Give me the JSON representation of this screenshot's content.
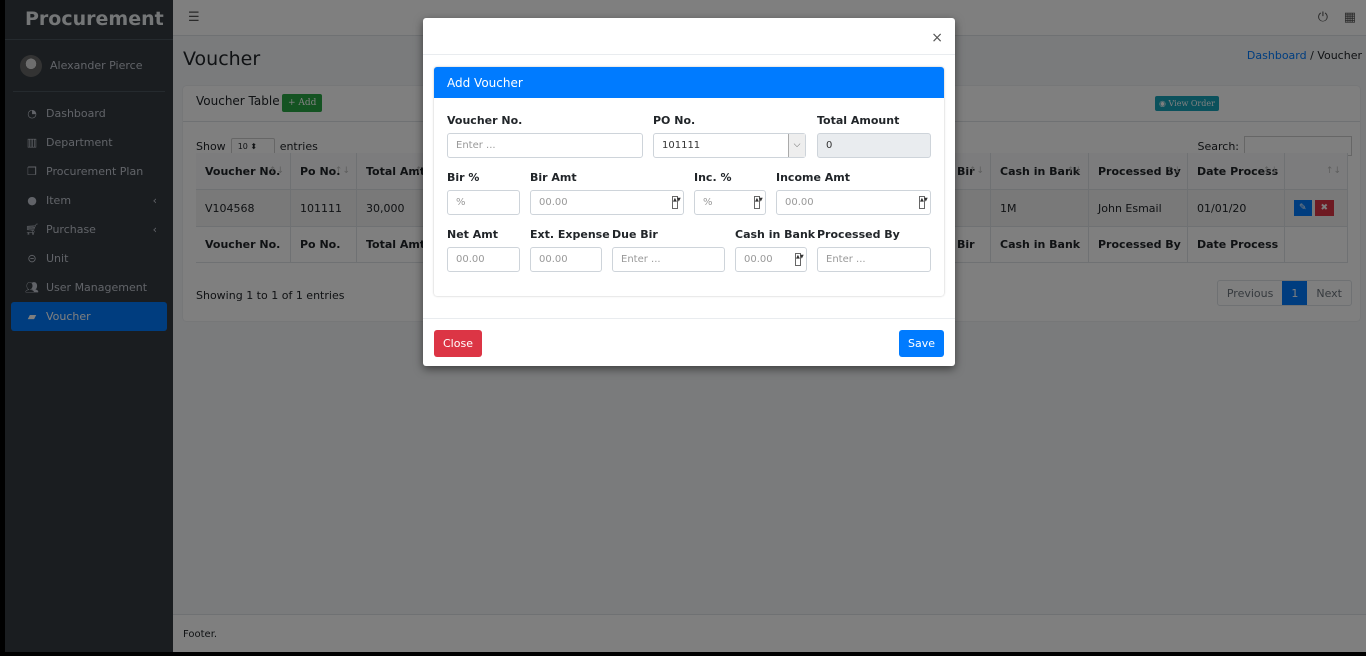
{
  "sidebar": {
    "brand": "Procurement",
    "user": "Alexander Pierce",
    "items": [
      {
        "label": "Dashboard",
        "icon": "tachometer-icon"
      },
      {
        "label": "Department",
        "icon": "building-icon"
      },
      {
        "label": "Procurement Plan",
        "icon": "copy-icon"
      },
      {
        "label": "Item",
        "icon": "palette-icon"
      },
      {
        "label": "Purchase",
        "icon": "cart-icon"
      },
      {
        "label": "Unit",
        "icon": "gamepad-icon"
      },
      {
        "label": "User Management",
        "icon": "users-icon"
      },
      {
        "label": "Voucher",
        "icon": "sticky-note-icon"
      }
    ]
  },
  "page": {
    "title": "Voucher",
    "breadcrumb": [
      "Dashboard",
      "Voucher"
    ]
  },
  "card": {
    "title": "Voucher Table",
    "add": "+ Add",
    "view_order": "View Order",
    "show": "Show",
    "entries_value": "10",
    "entries": "entries",
    "search": "Search:",
    "headers": [
      "Voucher No.",
      "Po No.",
      "Total Amt",
      "Bir",
      "Cash in Bank",
      "Processed By",
      "Date Process"
    ],
    "row": [
      "V104568",
      "101111",
      "30,000",
      "1M",
      "John Esmail",
      "01/01/20"
    ],
    "info": "Showing 1 to 1 of 1 entries",
    "pager": [
      "Previous",
      "1",
      "Next"
    ]
  },
  "footer": "Footer.",
  "modal": {
    "title": "Add Voucher",
    "close_x": "×",
    "fields": {
      "voucher_no": {
        "label": "Voucher No.",
        "placeholder": "Enter ..."
      },
      "po_no": {
        "label": "PO No.",
        "value": "101111"
      },
      "total_amount": {
        "label": "Total Amount",
        "value": "0"
      },
      "bir_pct": {
        "label": "Bir %",
        "placeholder": "%"
      },
      "bir_amt": {
        "label": "Bir Amt",
        "placeholder": "00.00"
      },
      "inc_pct": {
        "label": "Inc. %",
        "placeholder": "%"
      },
      "income_amt": {
        "label": "Income Amt",
        "placeholder": "00.00"
      },
      "net_amt": {
        "label": "Net Amt",
        "placeholder": "00.00"
      },
      "ext_expense": {
        "label": "Ext. Expense",
        "placeholder": "00.00"
      },
      "due_bir": {
        "label": "Due Bir",
        "placeholder": "Enter ..."
      },
      "cash_in_bank": {
        "label": "Cash in Bank",
        "placeholder": "00.00"
      },
      "processed_by": {
        "label": "Processed By",
        "placeholder": "Enter ..."
      }
    },
    "close": "Close",
    "save": "Save"
  }
}
